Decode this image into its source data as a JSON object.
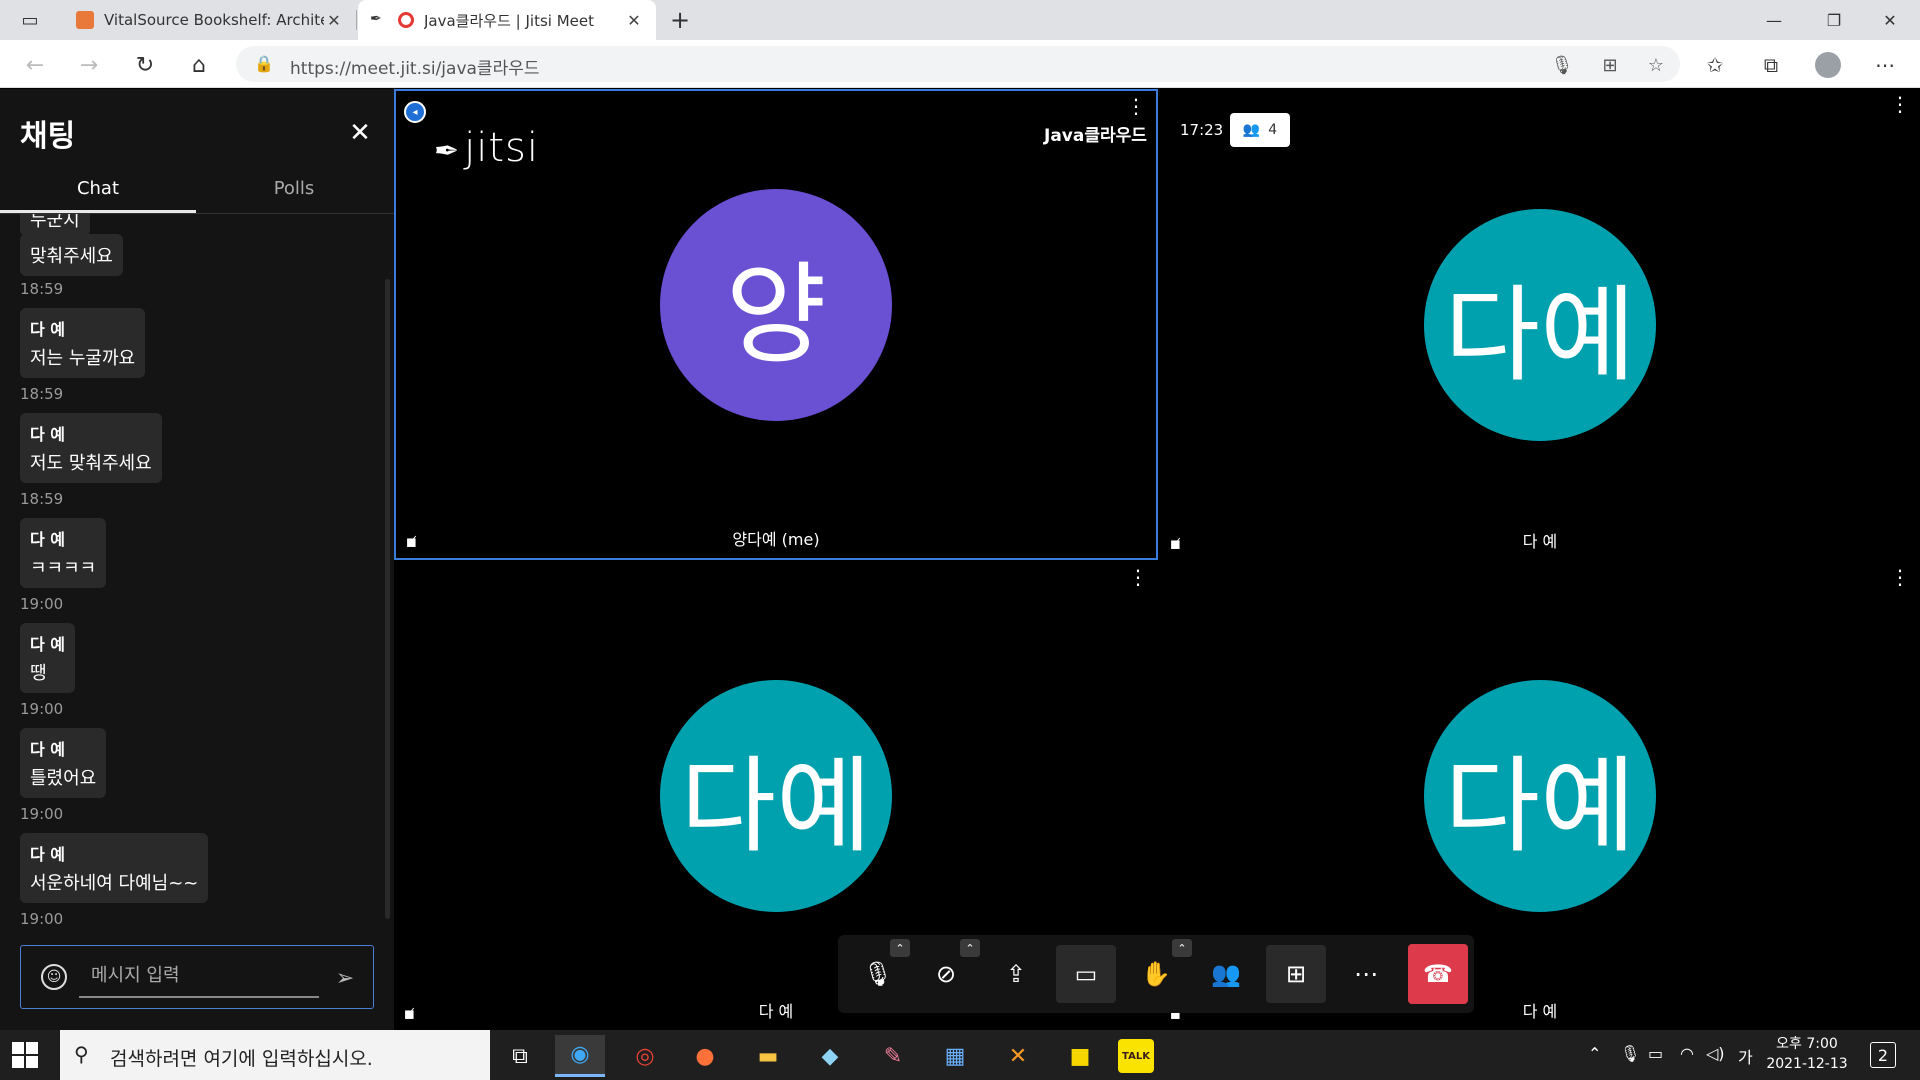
{
  "browser": {
    "tabs": [
      {
        "title": "VitalSource Bookshelf: Architecti",
        "active": false
      },
      {
        "title": "Java클라우드 | Jitsi Meet",
        "active": true
      }
    ],
    "url": "https://meet.jit.si/java클라우드"
  },
  "chat": {
    "title": "채팅",
    "tabs": {
      "chat": "Chat",
      "polls": "Polls"
    },
    "partial_top": "누군지",
    "messages": [
      {
        "sender": "",
        "text": "맞춰주세요",
        "time": "18:59"
      },
      {
        "sender": "다 예",
        "text": "저는 누굴까요",
        "time": "18:59"
      },
      {
        "sender": "다 예",
        "text": "저도 맞춰주세요",
        "time": "18:59"
      },
      {
        "sender": "다 예",
        "text": "ㅋㅋㅋㅋ",
        "time": "19:00"
      },
      {
        "sender": "다 예",
        "text": "땡",
        "time": "19:00"
      },
      {
        "sender": "다 예",
        "text": "틀렸어요",
        "time": "19:00"
      },
      {
        "sender": "다 예",
        "text": "서운하네여 다예님~~",
        "time": "19:00"
      }
    ],
    "input_placeholder": "메시지 입력"
  },
  "meeting": {
    "name": "Java클라우드",
    "timer": "17:23",
    "participant_count": "4",
    "logo_text": "jitsi",
    "tiles": [
      {
        "avatar": "양",
        "name": "양다예 (me)",
        "color": "#6a50d3"
      },
      {
        "avatar": "다예",
        "name": "다 예",
        "color": "#00a1ae"
      },
      {
        "avatar": "다예",
        "name": "다 예",
        "color": "#00a1ae"
      },
      {
        "avatar": "다예",
        "name": "다 예",
        "color": "#00a1ae"
      }
    ]
  },
  "taskbar": {
    "search_placeholder": "검색하려면 여기에 입력하십시오.",
    "ime": "가",
    "time": "오후 7:00",
    "date": "2021-12-13",
    "notifications": "2"
  }
}
